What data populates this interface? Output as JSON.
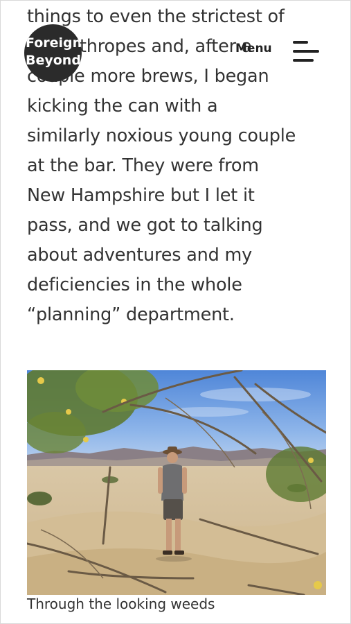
{
  "logo": {
    "line1": "Foreign",
    "line2": "Beyond"
  },
  "header": {
    "menu_label": "Menu"
  },
  "article": {
    "lines": [
      "things to even the strictest of",
      "misanthropes and, after a",
      "couple more brews, I began",
      "kicking the can with a",
      "similarly noxious young couple",
      "at the bar. They were from",
      "New Hampshire but I let it",
      "pass, and we got to talking",
      "about adventures and my",
      "deficiencies in the whole",
      "“planning” department."
    ]
  },
  "figure": {
    "caption": "Through the looking weeds"
  }
}
